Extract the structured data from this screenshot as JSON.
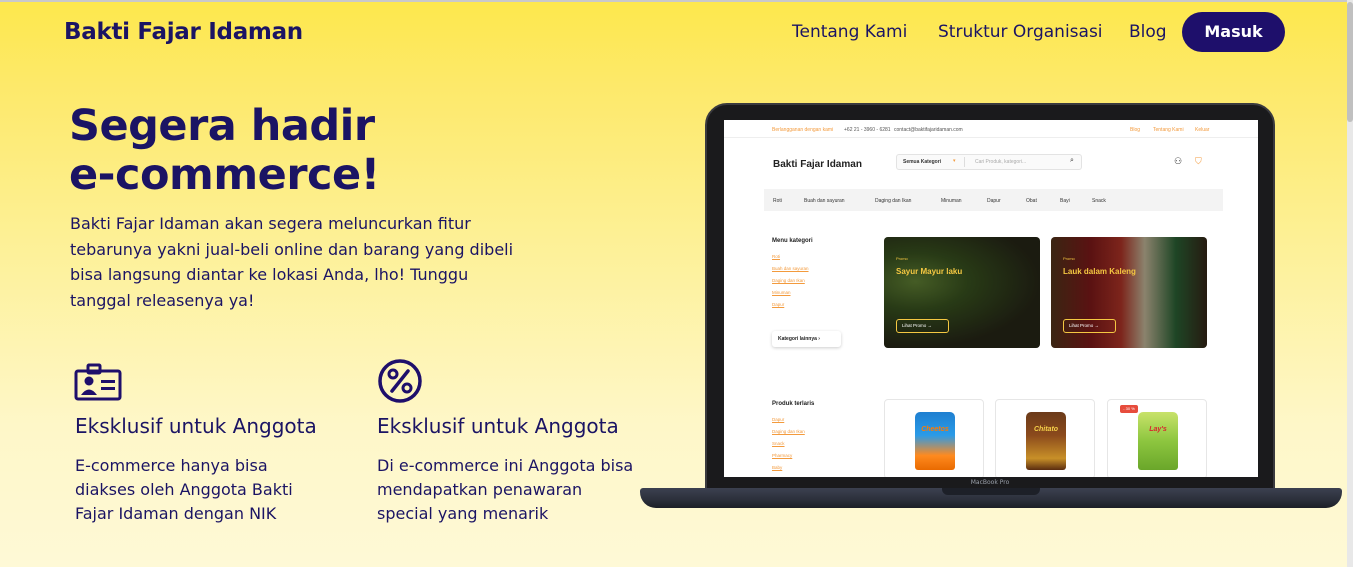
{
  "header": {
    "brand": "Bakti Fajar Idaman",
    "nav": [
      "Tentang Kami",
      "Struktur Organisasi",
      "Blog"
    ],
    "login_label": "Masuk"
  },
  "hero": {
    "title_line1": "Segera hadir",
    "title_line2": "e-commerce!",
    "description": "Bakti Fajar Idaman akan segera meluncurkan fitur tebarunya yakni jual-beli online dan barang yang dibeli bisa langsung diantar ke lokasi Anda, lho! Tunggu tanggal releasenya ya!"
  },
  "features": [
    {
      "icon": "id-card-icon",
      "title": "Eksklusif untuk Anggota",
      "description": "E-commerce hanya bisa diakses oleh Anggota Bakti Fajar Idaman dengan NIK"
    },
    {
      "icon": "percent-icon",
      "title": "Eksklusif untuk Anggota",
      "description": "Di e-commerce ini Anggota bisa mendapatkan penawaran special yang menarik"
    }
  ],
  "laptop": {
    "label": "MacBook Pro",
    "screen": {
      "top_bar": {
        "left_text": "Berlangganan dengan kami",
        "phone": "+62 21 - 3960 - 6281",
        "email": "contact@baktifajaridaman.com",
        "links": [
          "Blog",
          "Tentang Kami",
          "Keluar"
        ]
      },
      "brand": "Bakti Fajar Idaman",
      "search": {
        "category": "Semua Kategori",
        "placeholder": "Cari Produk, kategori..."
      },
      "menu": [
        "Roti",
        "Buah dan sayuran",
        "Daging dan Ikan",
        "Minuman",
        "Dapur",
        "Obat",
        "Bayi",
        "Snack"
      ],
      "sidebar_categories": {
        "title": "Menu kategori",
        "items": [
          "Roti",
          "Buah dan sayuran",
          "Daging dan Ikan",
          "Minuman",
          "Dapur"
        ],
        "more_button": "Kategori lainnya"
      },
      "promos": [
        {
          "tag": "Promo",
          "title": "Sayur Mayur laku",
          "button": "Lihat Promo"
        },
        {
          "tag": "Promo",
          "title": "Lauk dalam Kaleng",
          "button": "Lihat Promo"
        }
      ],
      "best_sellers": {
        "title": "Produk terlaris",
        "items": [
          "Dapur",
          "Daging dan Ikan",
          "Snack",
          "Pharmacy",
          "Baby"
        ]
      },
      "products": [
        {
          "brand_text": "Cheetos"
        },
        {
          "brand_text": "Chitato"
        },
        {
          "brand_text": "Lay's",
          "badge": "- 30 %"
        }
      ]
    }
  },
  "colors": {
    "primary": "#1e0f6b",
    "accent": "#f39a3c",
    "background_top": "#fde84c",
    "background_bottom": "#fef9d6"
  }
}
